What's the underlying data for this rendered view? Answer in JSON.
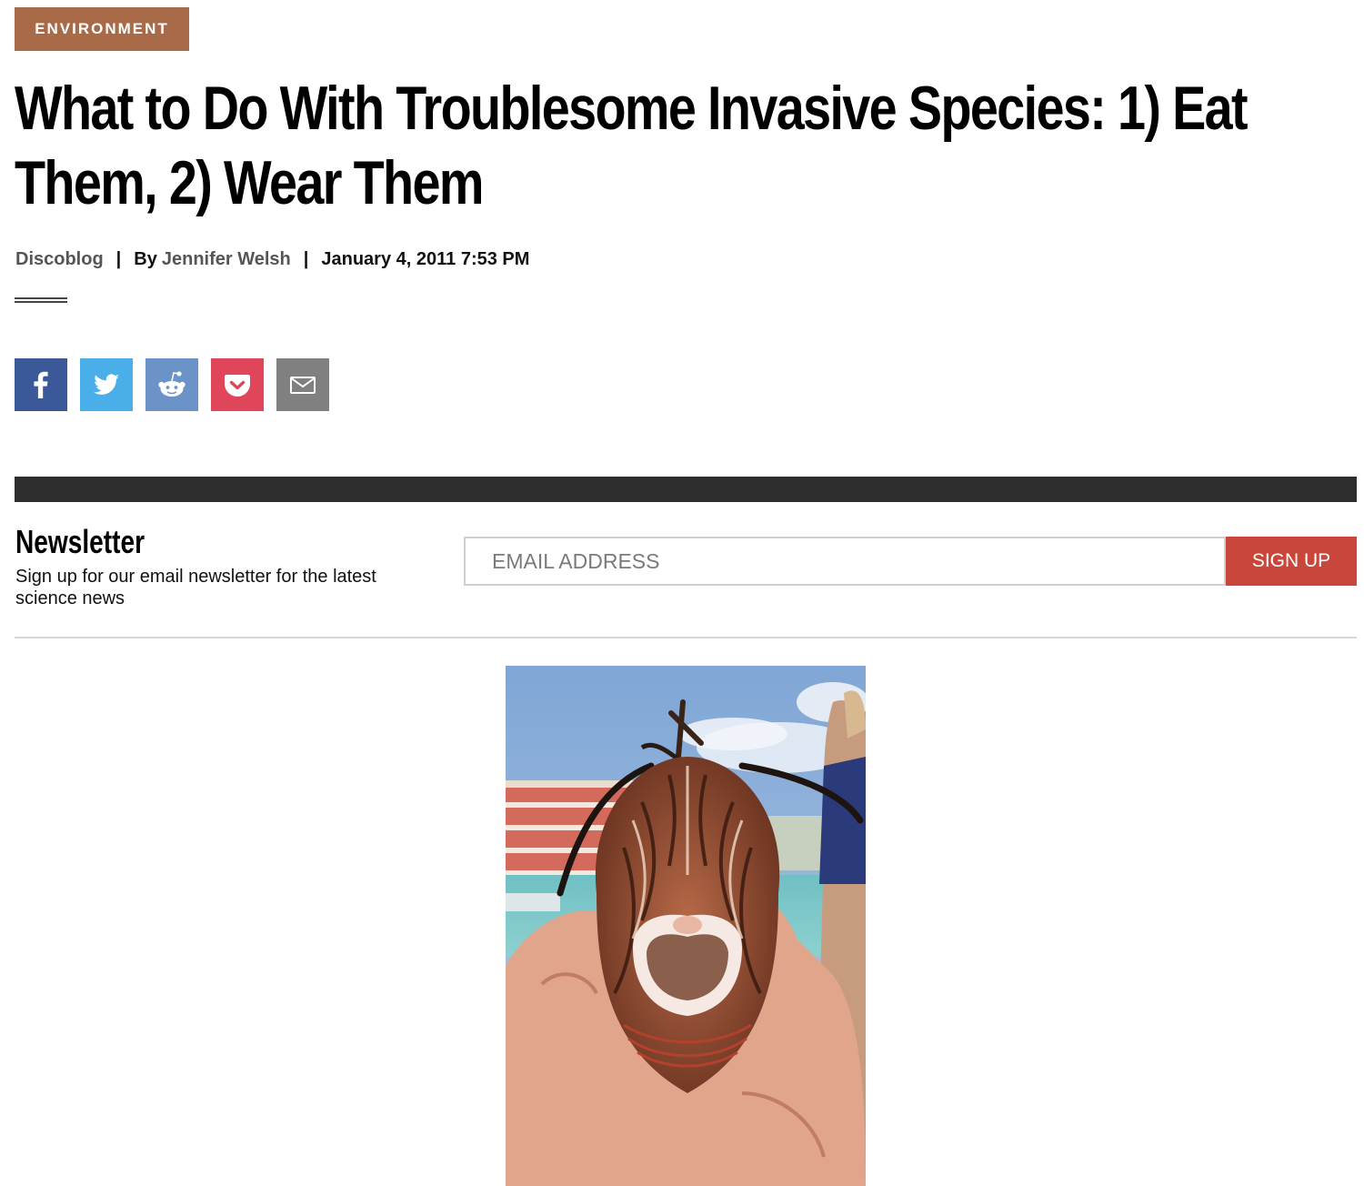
{
  "category": {
    "label": "ENVIRONMENT",
    "color": "#a86a47"
  },
  "article": {
    "title": "What to Do With Troublesome Invasive Species: 1) Eat Them, 2) Wear Them",
    "byline": {
      "blog": "Discoblog",
      "separator": "|",
      "by_prefix": "By",
      "author": "Jennifer Welsh",
      "date": "January 4, 2011 7:53 PM"
    }
  },
  "share_buttons": [
    {
      "name": "facebook",
      "icon": "facebook-icon",
      "color": "#3b5998"
    },
    {
      "name": "twitter",
      "icon": "twitter-icon",
      "color": "#4aaee8"
    },
    {
      "name": "reddit",
      "icon": "reddit-icon",
      "color": "#6c93c8"
    },
    {
      "name": "pocket",
      "icon": "pocket-icon",
      "color": "#e0465a"
    },
    {
      "name": "email",
      "icon": "envelope-icon",
      "color": "#808080"
    }
  ],
  "newsletter": {
    "title": "Newsletter",
    "description": "Sign up for our email newsletter for the latest science news",
    "email_placeholder": "EMAIL ADDRESS",
    "button_label": "SIGN UP",
    "button_color": "#c9473a"
  },
  "hero_image": {
    "subject": "lionfish held in hand"
  }
}
